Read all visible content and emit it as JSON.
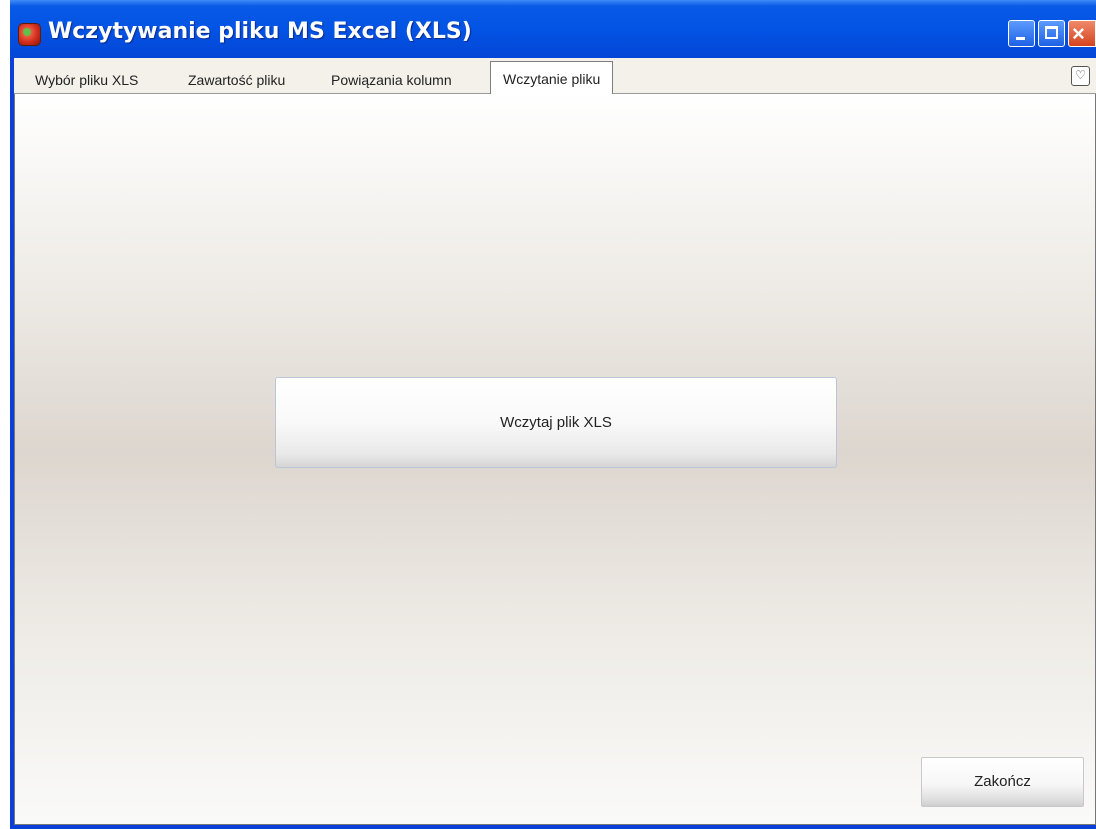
{
  "window": {
    "title": "Wczytywanie pliku MS Excel (XLS)",
    "close_glyph": "×"
  },
  "tabs": [
    {
      "label": "Wybór pliku XLS",
      "active": false
    },
    {
      "label": "Zawartość pliku",
      "active": false
    },
    {
      "label": "Powiązania kolumn",
      "active": false
    },
    {
      "label": "Wczytanie pliku",
      "active": true
    }
  ],
  "tab_menu": {
    "glyph": "♡"
  },
  "main": {
    "load_button_label": "Wczytaj plik XLS",
    "finish_button_label": "Zakończ"
  },
  "colors": {
    "titlebar": "#0353e4",
    "panel_mid": "#ddd6cf"
  }
}
